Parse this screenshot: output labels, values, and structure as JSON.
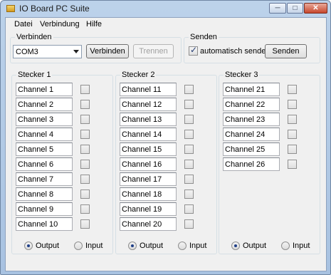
{
  "window": {
    "title": "IO Board PC Suite",
    "controls": {
      "minimize": "─",
      "maximize": "□",
      "close": "✕"
    }
  },
  "menu": {
    "items": [
      "Datei",
      "Verbindung",
      "Hilfe"
    ]
  },
  "verbinden": {
    "label": "Verbinden",
    "port": "COM3",
    "connect_label": "Verbinden",
    "disconnect_label": "Trennen"
  },
  "senden": {
    "label": "Senden",
    "auto_send_label": "automatisch senden",
    "auto_send_checked": true,
    "send_label": "Senden"
  },
  "stecker": [
    {
      "label": "Stecker 1",
      "channels": [
        "Channel 1",
        "Channel 2",
        "Channel 3",
        "Channel 4",
        "Channel 5",
        "Channel 6",
        "Channel 7",
        "Channel 8",
        "Channel 9",
        "Channel 10"
      ],
      "output_label": "Output",
      "input_label": "Input",
      "mode": "Output"
    },
    {
      "label": "Stecker 2",
      "channels": [
        "Channel 11",
        "Channel 12",
        "Channel 13",
        "Channel 14",
        "Channel 15",
        "Channel 16",
        "Channel 17",
        "Channel 18",
        "Channel 19",
        "Channel 20"
      ],
      "output_label": "Output",
      "input_label": "Input",
      "mode": "Output"
    },
    {
      "label": "Stecker 3",
      "channels": [
        "Channel 21",
        "Channel 22",
        "Channel 23",
        "Channel 24",
        "Channel 25",
        "Channel 26"
      ],
      "output_label": "Output",
      "input_label": "Input",
      "mode": "Output"
    }
  ]
}
